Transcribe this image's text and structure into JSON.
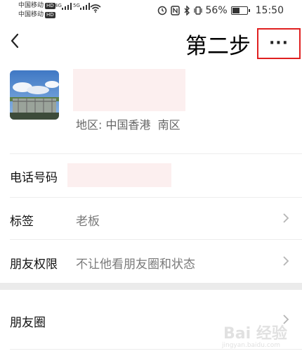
{
  "status_bar": {
    "carrier1": "中国移动",
    "carrier2": "中国移动",
    "hd": "HD",
    "net1": "4G",
    "net2": "5G",
    "battery_pct": "56%",
    "battery_level": 0.56,
    "time": "15:50"
  },
  "nav": {
    "back_icon": "chevron-left-icon",
    "step_text": "第二步",
    "more_label": "···"
  },
  "profile": {
    "region": "地区: 中国香港  南区"
  },
  "rows": {
    "phone_label": "电话号码",
    "tags_label": "标签",
    "tags_value": "老板",
    "perm_label": "朋友权限",
    "perm_value": "不让他看朋友圈和状态",
    "moments_label": "朋友圈"
  },
  "watermark": {
    "text": "Bai 经验",
    "sub": "jingyan.baidu.com"
  },
  "colors": {
    "highlight": "#e02020",
    "blur": "#fcefef"
  }
}
